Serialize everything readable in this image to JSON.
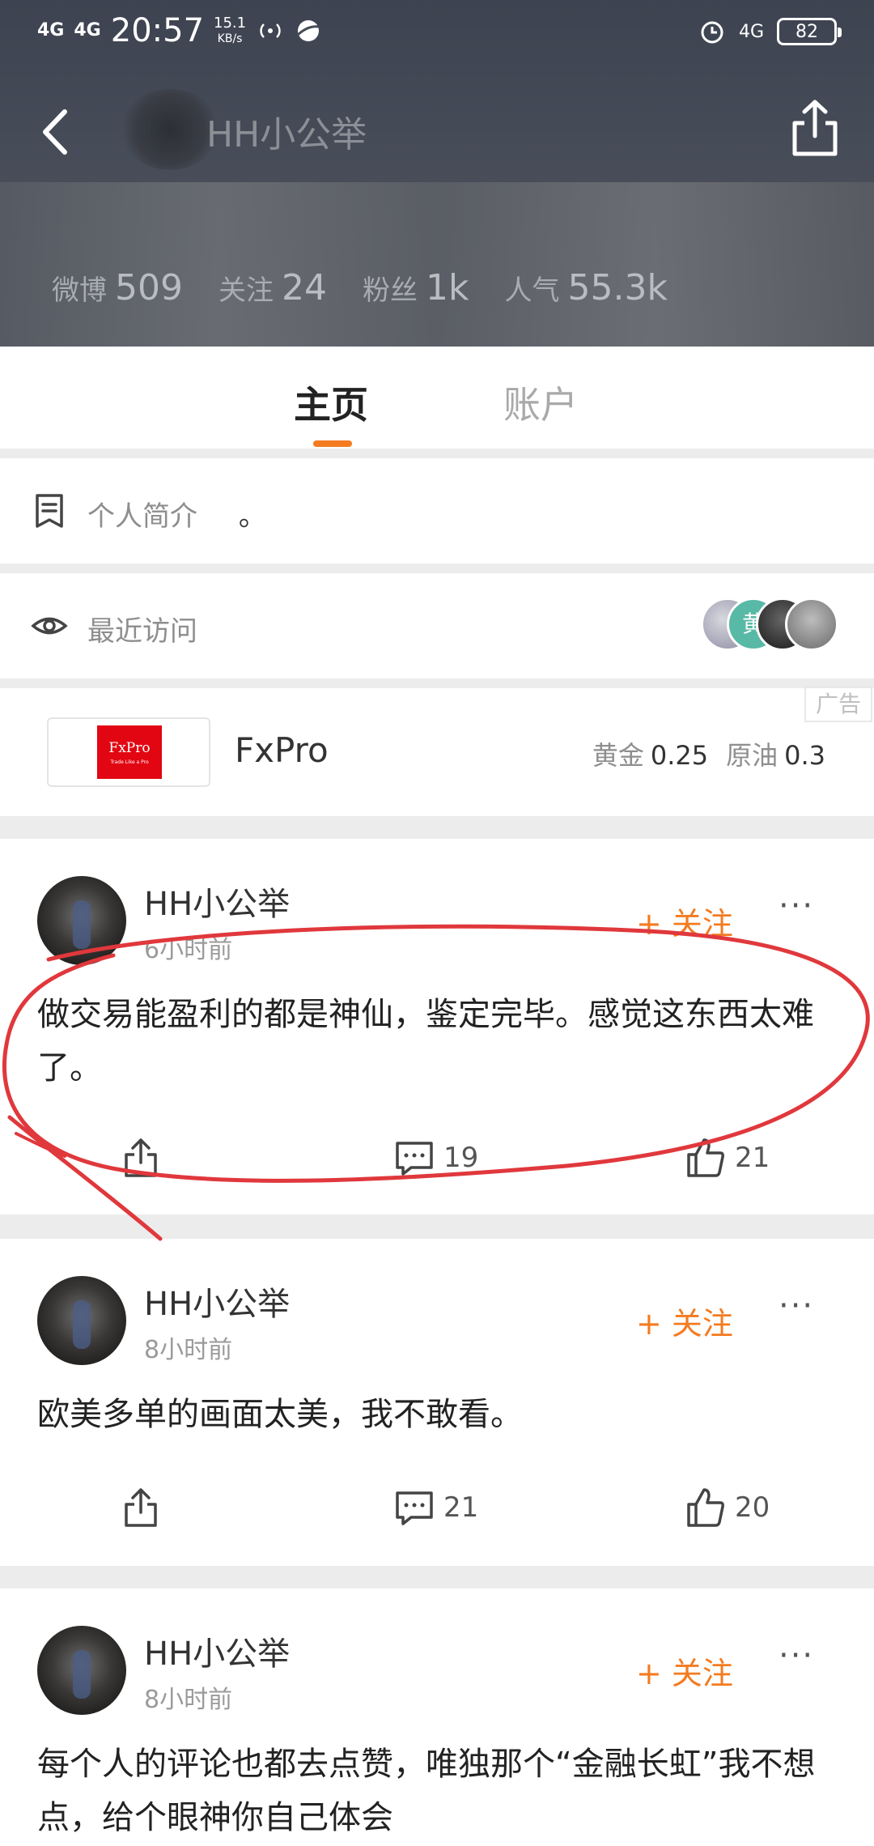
{
  "status_bar": {
    "signal1": "4G",
    "signal2": "4G",
    "time": "20:57",
    "speed_value": "15.1",
    "speed_unit": "KB/s",
    "network_right": "4G",
    "battery": "82"
  },
  "profile": {
    "name": "HH小公举",
    "stats": [
      {
        "label": "微博",
        "value": "509"
      },
      {
        "label": "关注",
        "value": "24"
      },
      {
        "label": "粉丝",
        "value": "1k"
      },
      {
        "label": "人气",
        "value": "55.3k"
      }
    ]
  },
  "tabs": [
    {
      "label": "主页",
      "active": true
    },
    {
      "label": "账户",
      "active": false
    }
  ],
  "intro": {
    "label": "个人简介",
    "value": "。"
  },
  "recent_visits": {
    "label": "最近访问",
    "visitor_letter": "黄"
  },
  "ad": {
    "logo_text": "FxPro",
    "logo_tagline": "Trade Like a Pro",
    "name": "FxPro",
    "tag": "广告",
    "quotes": [
      {
        "label": "黄金",
        "value": "0.25"
      },
      {
        "label": "原油",
        "value": "0.3"
      }
    ]
  },
  "posts": [
    {
      "author": "HH小公举",
      "time": "6小时前",
      "follow": "+ 关注",
      "more": "···",
      "text": "做交易能盈利的都是神仙，鉴定完毕。感觉这东西太难了。",
      "comments": "19",
      "likes": "21"
    },
    {
      "author": "HH小公举",
      "time": "8小时前",
      "follow": "+ 关注",
      "more": "···",
      "text": "欧美多单的画面太美，我不敢看。",
      "comments": "21",
      "likes": "20"
    },
    {
      "author": "HH小公举",
      "time": "8小时前",
      "follow": "+ 关注",
      "more": "···",
      "text": "每个人的评论也都去点赞，唯独那个“金融长虹”我不想点，给个眼神你自己体会",
      "comments": "",
      "likes": ""
    }
  ],
  "colors": {
    "accent": "#f47b20",
    "header_bg": "#454b57",
    "annotation_red": "#e0383c"
  }
}
